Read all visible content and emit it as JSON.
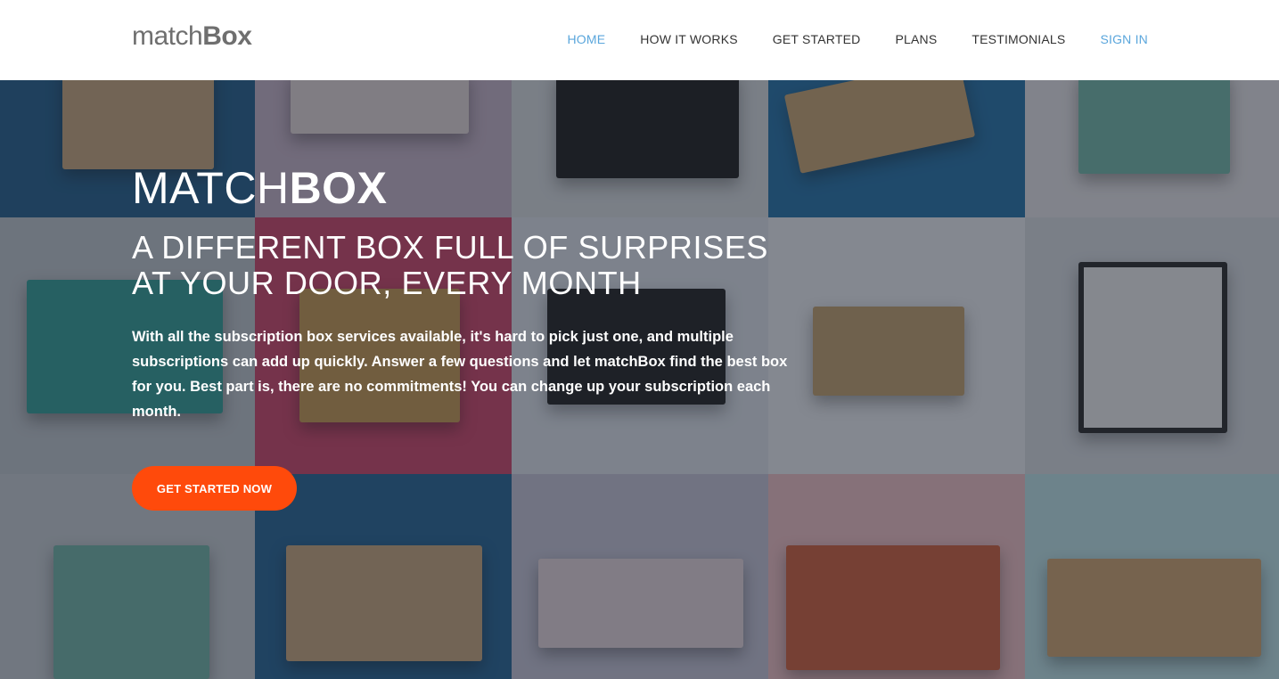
{
  "header": {
    "logo_light": "match",
    "logo_bold": "Box",
    "nav": [
      {
        "label": "HOME"
      },
      {
        "label": "HOW IT WORKS"
      },
      {
        "label": "GET STARTED"
      },
      {
        "label": "PLANS"
      },
      {
        "label": "TESTIMONIALS"
      },
      {
        "label": "SIGN IN"
      }
    ]
  },
  "hero": {
    "brand_light": "MATCH",
    "brand_bold": "BOX",
    "tagline_line1": "A DIFFERENT BOX FULL OF SURPRISES",
    "tagline_line2": "AT YOUR DOOR, EVERY MONTH",
    "description": "With all the subscription box services available, it's hard to pick just one, and multiple subscriptions can add up quickly. Answer a few questions and let matchBox find the best box for you. Best part is, there are no commitments! You can change up your subscription each month.",
    "cta_label": "GET STARTED NOW"
  },
  "colors": {
    "nav_active": "#5aa6dc",
    "cta": "#ff4a0b",
    "logo": "#6f6f6f"
  }
}
